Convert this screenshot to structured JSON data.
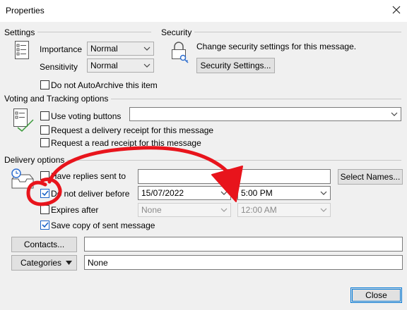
{
  "window": {
    "title": "Properties"
  },
  "colors": {
    "annotation_red": "#e8141c",
    "checkbox_blue": "#1a63c8",
    "focus_blue": "#0078d7"
  },
  "settings": {
    "group_label": "Settings",
    "importance_label": "Importance",
    "importance_value": "Normal",
    "sensitivity_label": "Sensitivity",
    "sensitivity_value": "Normal",
    "do_not_autoarchive": {
      "label": "Do not AutoArchive this item",
      "checked": false
    }
  },
  "security": {
    "group_label": "Security",
    "description": "Change security settings for this message.",
    "button_label": "Security Settings..."
  },
  "voting": {
    "group_label": "Voting and Tracking options",
    "use_voting_buttons": {
      "label": "Use voting buttons",
      "checked": false,
      "value": ""
    },
    "delivery_receipt": {
      "label": "Request a delivery receipt for this message",
      "checked": false
    },
    "read_receipt": {
      "label": "Request a read receipt for this message",
      "checked": false
    }
  },
  "delivery": {
    "group_label": "Delivery options",
    "have_replies_sent_to": {
      "label": "Have replies sent to",
      "checked": false,
      "value": ""
    },
    "select_names_button": "Select Names...",
    "do_not_deliver_before": {
      "label": "Do not deliver before",
      "checked": true,
      "date": "15/07/2022",
      "time": "5:00 PM"
    },
    "expires_after": {
      "label": "Expires after",
      "checked": false,
      "date": "None",
      "time": "12:00 AM"
    },
    "save_copy": {
      "label": "Save copy of sent message",
      "checked": true
    }
  },
  "contacts": {
    "button_label": "Contacts...",
    "value": ""
  },
  "categories": {
    "button_label": "Categories",
    "value": "None"
  },
  "footer": {
    "close_label": "Close"
  },
  "icons": {
    "close": "close-icon",
    "settings": "checklist-icon",
    "security": "lock-key-icon",
    "voting": "checklist-check-icon",
    "delivery": "tray-clock-icon",
    "dropdown": "chevron-down-icon"
  }
}
